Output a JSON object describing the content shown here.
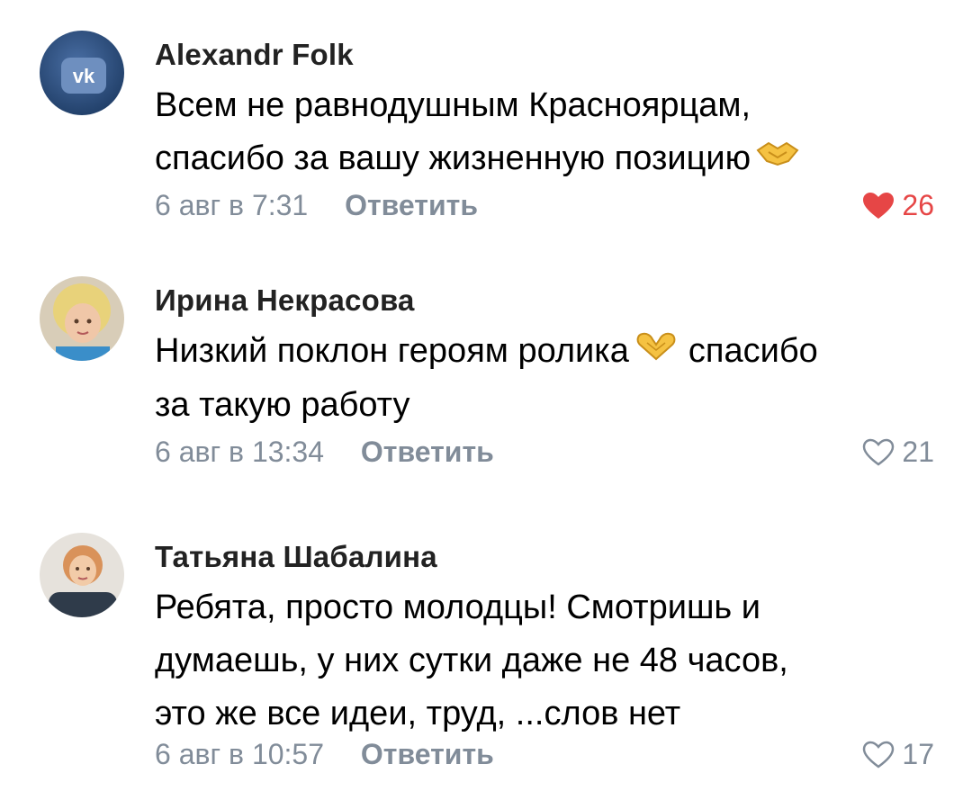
{
  "comments": [
    {
      "author": "Alexandr Folk",
      "text_lines": [
        "Всем не равнодушным Красноярцам,",
        "спасибо за вашу жизненную позицию"
      ],
      "date": "6 авг в 7:31",
      "reply_label": "Ответить",
      "likes": "26",
      "liked": true,
      "avatar_icon": "vk-logo-icon",
      "trailing_emoji": "handshake-icon"
    },
    {
      "author": "Ирина Некрасова",
      "text_lines": [
        "Низкий поклон героям ролика",
        "за такую работу"
      ],
      "inline_after_emoji": "спасибо",
      "date": "6 авг в 13:34",
      "reply_label": "Ответить",
      "likes": "21",
      "liked": false,
      "avatar_icon": "user-photo-icon",
      "trailing_emoji": "heart-hands-icon"
    },
    {
      "author": "Татьяна Шабалина",
      "text_lines": [
        "Ребята, просто молодцы! Смотришь и",
        "думаешь, у них сутки даже не 48 часов,",
        "это же все идеи, труд, ...слов нет"
      ],
      "date": "6 авг в 10:57",
      "reply_label": "Ответить",
      "likes": "17",
      "liked": false,
      "avatar_icon": "user-photo-icon"
    }
  ],
  "colors": {
    "meta": "#818c99",
    "like_active": "#e64646",
    "author": "#222222"
  }
}
